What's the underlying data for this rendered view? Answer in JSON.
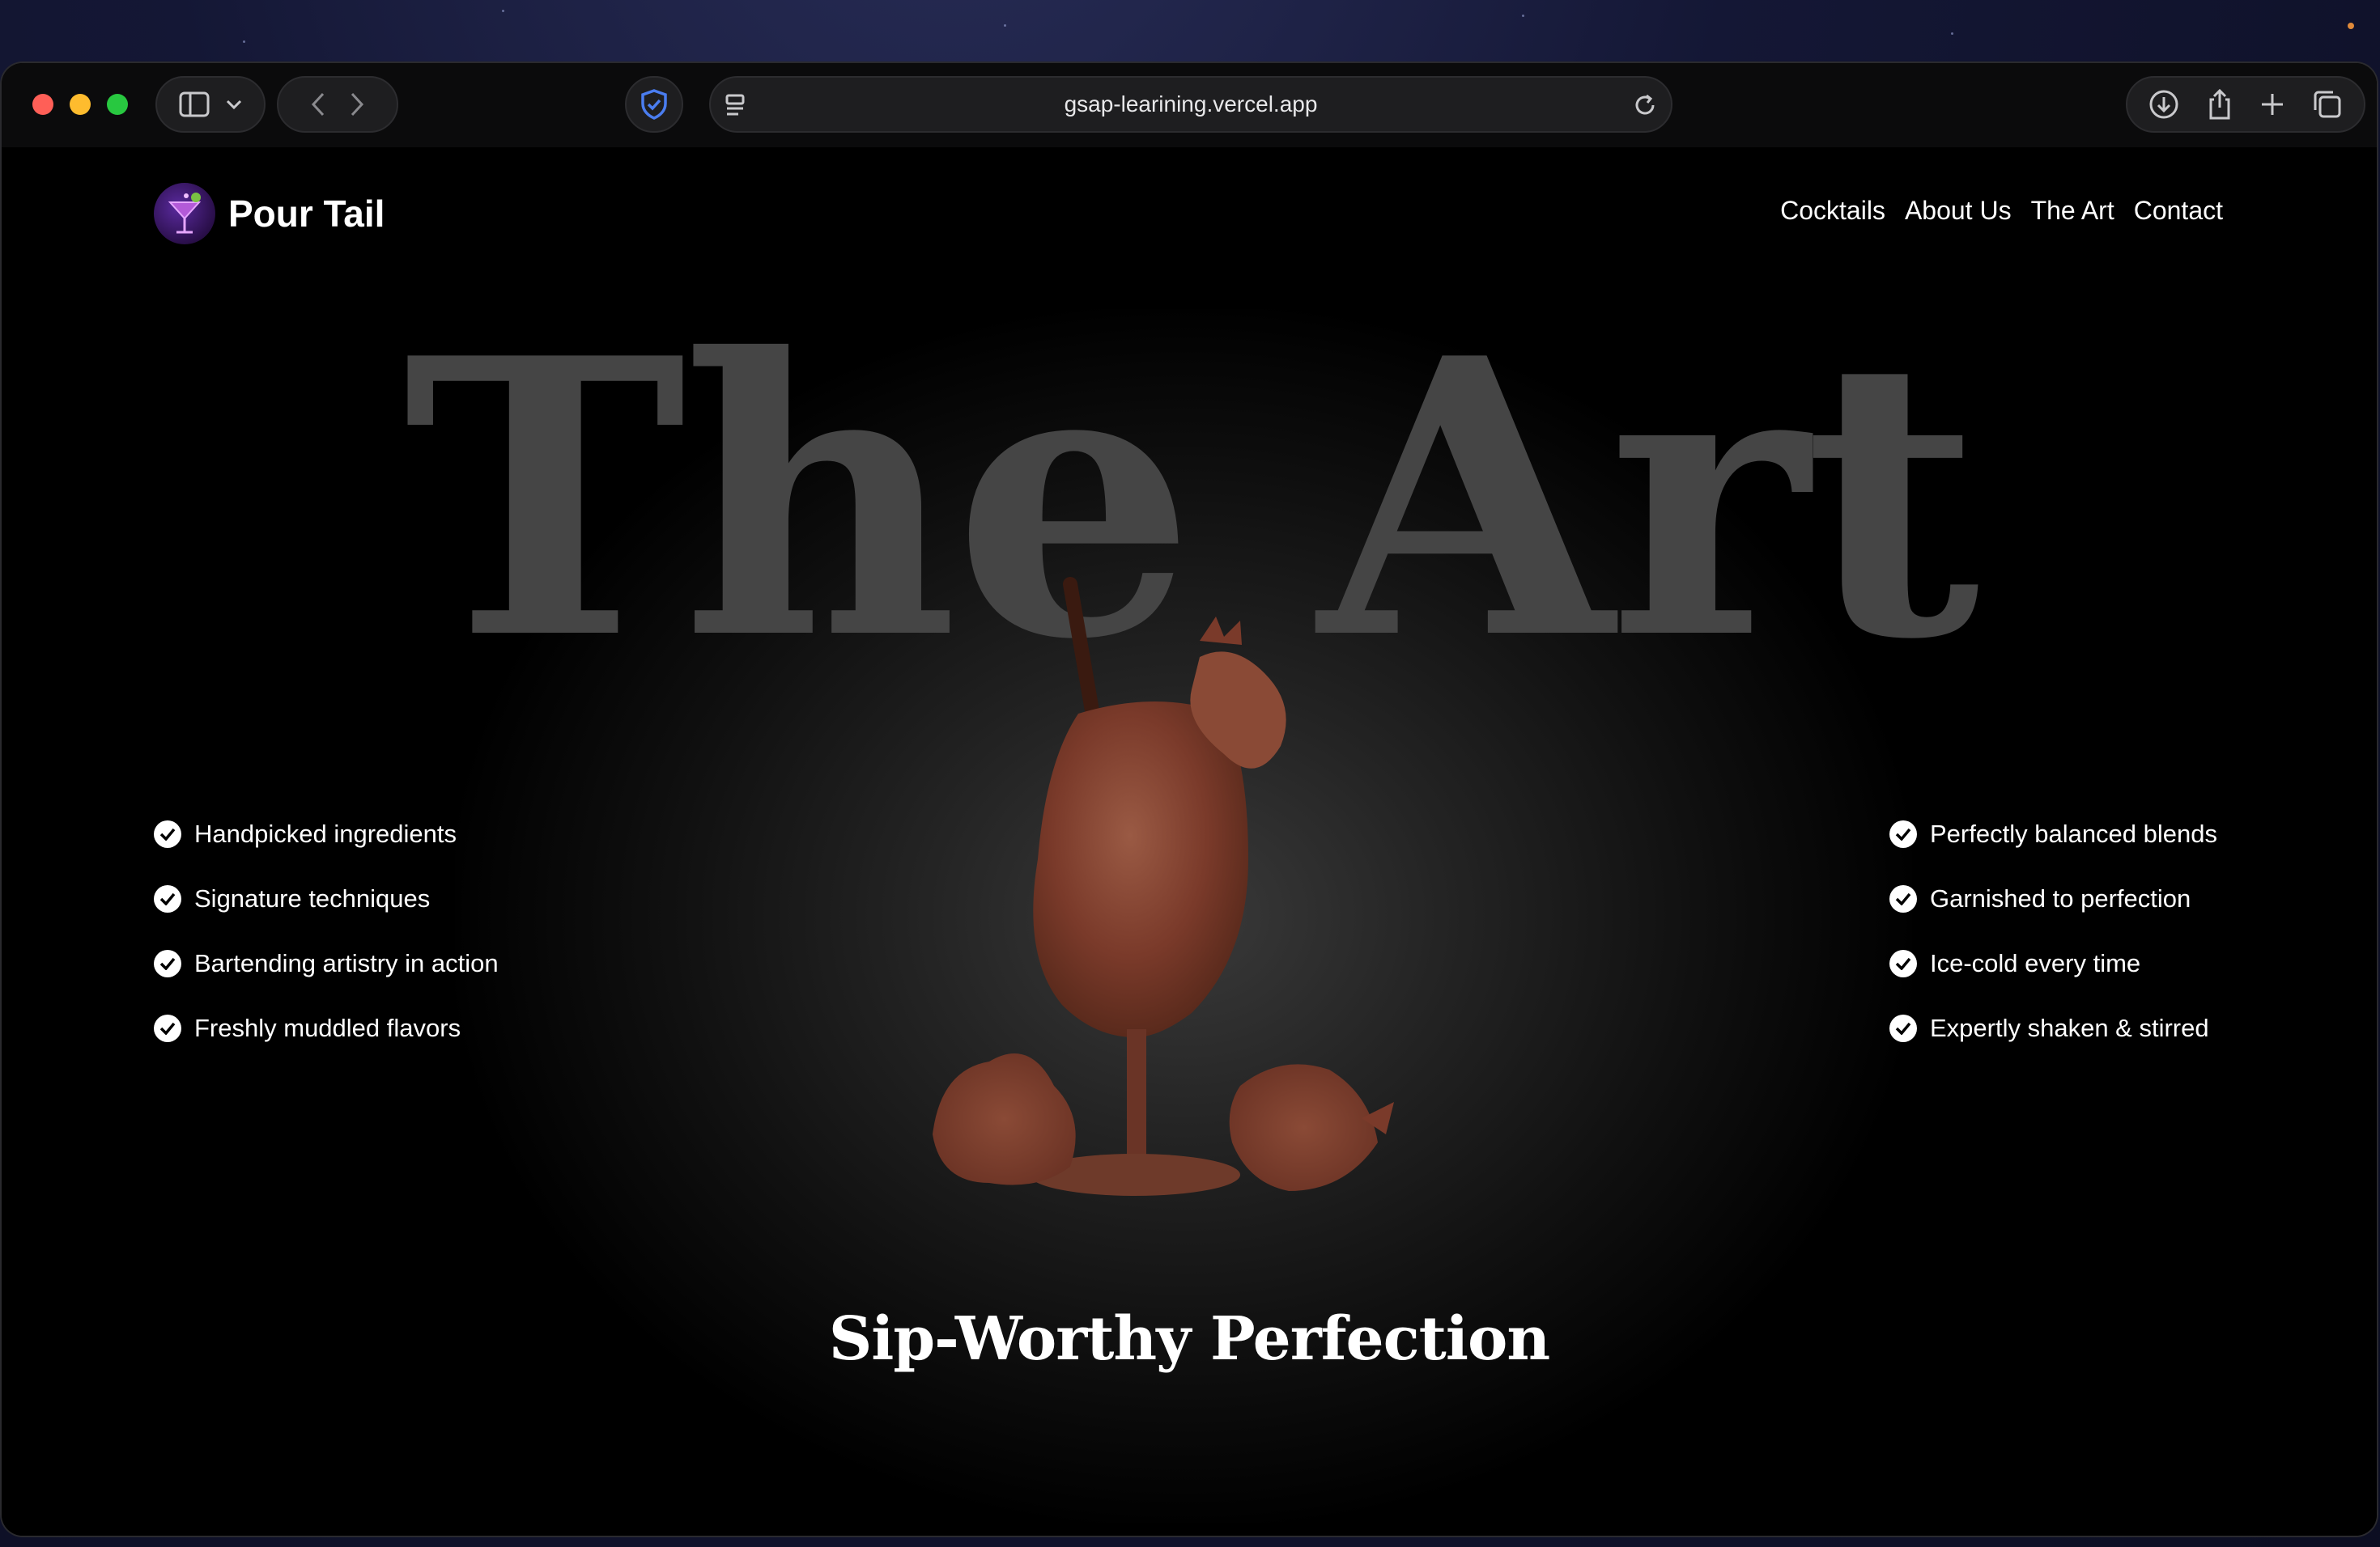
{
  "browser": {
    "url": "gsap-learining.vercel.app"
  },
  "site": {
    "brand": "Pour Tail",
    "nav": [
      "Cocktails",
      "About Us",
      "The Art",
      "Contact"
    ]
  },
  "hero": {
    "title": "The Art",
    "tagline": "Sip-Worthy Perfection"
  },
  "features": {
    "left": [
      "Handpicked ingredients",
      "Signature techniques",
      "Bartending artistry in action",
      "Freshly muddled flavors"
    ],
    "right": [
      "Perfectly balanced blends",
      "Garnished to perfection",
      "Ice-cold every time",
      "Expertly shaken & stirred"
    ]
  },
  "colors": {
    "background": "#000000",
    "title_gray": "#454545",
    "cocktail_brown": "#8a4a38"
  }
}
